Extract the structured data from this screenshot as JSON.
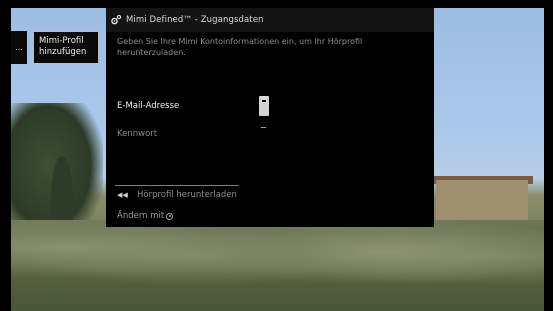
{
  "side_panel": {
    "label": "..."
  },
  "profile_panel": {
    "label_line1": "Mimi-Profil",
    "label_line2": "hinzufügen"
  },
  "dialog": {
    "title": "Mimi Defined™ - Zugangsdaten",
    "description": "Geben Sie Ihre Mimi Kontoinformationen ein, um Ihr Hörprofil herunterzuladen.",
    "email_label": "E-Mail-Adresse",
    "password_label": "Kennwort",
    "download_action": "Hörprofil herunterladen",
    "hint": "Ändern mit"
  },
  "icons": {
    "gear": "gear-icon",
    "rewind": "rewind-icon",
    "ok": "ok-button-icon"
  },
  "colors": {
    "dialog_bg": "#000000",
    "header_bg": "#141414",
    "text_active": "#f0f0f0",
    "text_inactive": "#8a8a8a"
  }
}
